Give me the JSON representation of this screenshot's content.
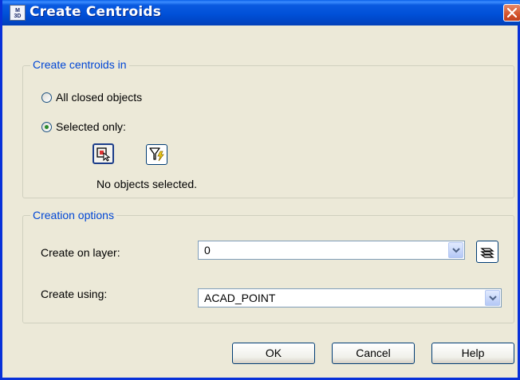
{
  "window": {
    "title": "Create Centroids",
    "app_icon_text": "M3D"
  },
  "group1": {
    "legend": "Create centroids in",
    "radio_all_label": "All closed objects",
    "radio_selected_label": "Selected only:",
    "selected_option": "Selected only:",
    "status": "No objects selected."
  },
  "group2": {
    "legend": "Creation options",
    "layer_label": "Create on layer:",
    "layer_value": "0",
    "using_label": "Create using:",
    "using_value": "ACAD_POINT"
  },
  "buttons": {
    "ok": "OK",
    "cancel": "Cancel",
    "help": "Help"
  },
  "colors": {
    "titlebar": "#0054e3",
    "legend_text": "#0046d5",
    "close_button": "#d3532c",
    "dialog_bg": "#ece9d8"
  }
}
